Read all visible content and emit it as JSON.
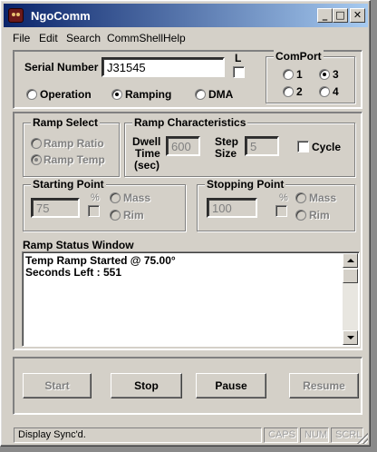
{
  "window": {
    "title": "NgoComm"
  },
  "menu": [
    "File",
    "Edit",
    "Search",
    "CommShell",
    "Help"
  ],
  "serial": {
    "label": "Serial Number",
    "value": "J31545",
    "l_label": "L"
  },
  "mode": {
    "options": [
      "Operation",
      "Ramping",
      "DMA"
    ],
    "selected": "Ramping"
  },
  "comport": {
    "title": "ComPort",
    "options": [
      "1",
      "3",
      "2",
      "4"
    ],
    "selected": "3"
  },
  "ramp_select": {
    "title": "Ramp Select",
    "options": [
      "Ramp Ratio",
      "Ramp Temp"
    ],
    "selected": "Ramp Temp"
  },
  "ramp_characteristics": {
    "title": "Ramp Characteristics",
    "dwell_label_1": "Dwell",
    "dwell_label_2": "Time",
    "dwell_label_3": "(sec)",
    "dwell_value": "600",
    "step_label_1": "Step",
    "step_label_2": "Size",
    "step_value": "5",
    "cycle_label": "Cycle"
  },
  "starting_point": {
    "title": "Starting Point",
    "value": "75",
    "percent": "%",
    "options": [
      "Mass",
      "Rim"
    ]
  },
  "stopping_point": {
    "title": "Stopping Point",
    "value": "100",
    "percent": "%",
    "options": [
      "Mass",
      "Rim"
    ]
  },
  "status_window": {
    "title": "Ramp Status Window",
    "lines": [
      "Temp Ramp Started @ 75.00°",
      "Seconds Left : 551"
    ]
  },
  "buttons": {
    "start": "Start",
    "stop": "Stop",
    "pause": "Pause",
    "resume": "Resume"
  },
  "statusbar": {
    "message": "Display Sync'd.",
    "caps": "CAPS",
    "num": "NUM",
    "scrl": "SCRL"
  }
}
